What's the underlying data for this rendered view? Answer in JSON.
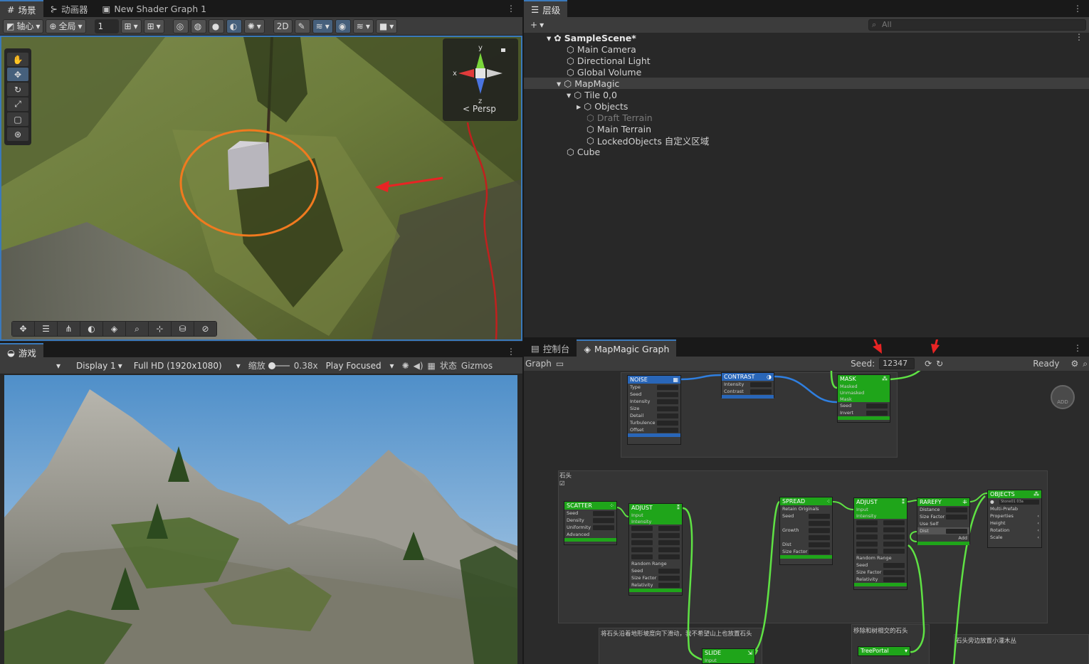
{
  "scene_panel": {
    "tabs": [
      {
        "label": "场景"
      },
      {
        "label": "动画器"
      },
      {
        "label": "New Shader Graph 1"
      }
    ],
    "toolbar": {
      "pivot": "轴心",
      "global": "全局",
      "grid_value": "1"
    },
    "gizmo": {
      "y": "y",
      "x": "x",
      "z": "z",
      "persp": "Persp"
    }
  },
  "hierarchy": {
    "tab": "层级",
    "search_placeholder": "All",
    "items": [
      {
        "label": "SampleScene*"
      },
      {
        "label": "Main Camera"
      },
      {
        "label": "Directional Light"
      },
      {
        "label": "Global Volume"
      },
      {
        "label": "MapMagic"
      },
      {
        "label": "Tile 0,0"
      },
      {
        "label": "Objects"
      },
      {
        "label": "Draft Terrain"
      },
      {
        "label": "Main Terrain"
      },
      {
        "label": "LockedObjects 自定义区域"
      },
      {
        "label": "Cube"
      }
    ]
  },
  "game_panel": {
    "tab": "游戏",
    "display": "Display 1",
    "resolution": "Full HD (1920x1080)",
    "scale_label": "缩放",
    "scale_value": "0.38x",
    "play_mode": "Play Focused",
    "stats": "状态",
    "gizmos": "Gizmos"
  },
  "graph_panel": {
    "tabs": [
      {
        "label": "控制台"
      },
      {
        "label": "MapMagic Graph"
      }
    ],
    "graph_label": "Graph",
    "seed_label": "Seed:",
    "seed_value": "12347",
    "status": "Ready",
    "add_label": "ADD",
    "groups": {
      "stone": "石头",
      "slide": "将石头沿着地形坡度向下滑动，我不希望山上也放置石头",
      "remove": "移除和树相交的石头",
      "bush": "石头旁边放置小灌木丛"
    },
    "nodes": {
      "noise": {
        "title": "NOISE",
        "rows": [
          "Type",
          "Seed",
          "Intensity",
          "Size",
          "Detail",
          "Turbulence",
          "Offset"
        ]
      },
      "contrast": {
        "title": "CONTRAST",
        "rows": [
          "Intensity",
          "Contrast"
        ]
      },
      "mask": {
        "title": "MASK",
        "rows": [
          "Masked",
          "Unmasked",
          "Mask",
          "Seed",
          "Invert"
        ]
      },
      "scatter": {
        "title": "SCATTER",
        "rows": [
          "Seed",
          "Density",
          "Uniformity",
          "Advanced"
        ]
      },
      "adjust1": {
        "title": "ADJUST",
        "rows": [
          "Input",
          "Intensity",
          "Random Range",
          "Seed",
          "Size Factor",
          "Relativity"
        ]
      },
      "spread": {
        "title": "SPREAD",
        "rows": [
          "Retain Originals",
          "Seed",
          "Growth",
          "Dist",
          "Size Factor"
        ]
      },
      "adjust2": {
        "title": "ADJUST",
        "rows": [
          "Input",
          "Intensity",
          "Random Range",
          "Seed",
          "Size Factor",
          "Relativity"
        ]
      },
      "rarefy": {
        "title": "RAREFY",
        "rows": [
          "Distance",
          "Size Factor",
          "Use Self",
          "Dist",
          "Add"
        ]
      },
      "objects": {
        "title": "OBJECTS",
        "rows": [
          "Stone01 03a",
          "Multi-Prefab",
          "Properties",
          "Height",
          "Rotation",
          "Scale"
        ]
      },
      "slide": {
        "title": "SLIDE",
        "rows": [
          "Input"
        ]
      },
      "treeportal": {
        "title": "TreePortal",
        "rows": []
      }
    }
  },
  "colors": {
    "accent": "#3a79bb",
    "node_green": "#1fa51a",
    "node_blue": "#2966b8",
    "wire_green": "#5fe244",
    "wire_blue": "#2f7fe0",
    "annotation_red": "#e82424",
    "annotation_orange": "#f07a1f"
  }
}
